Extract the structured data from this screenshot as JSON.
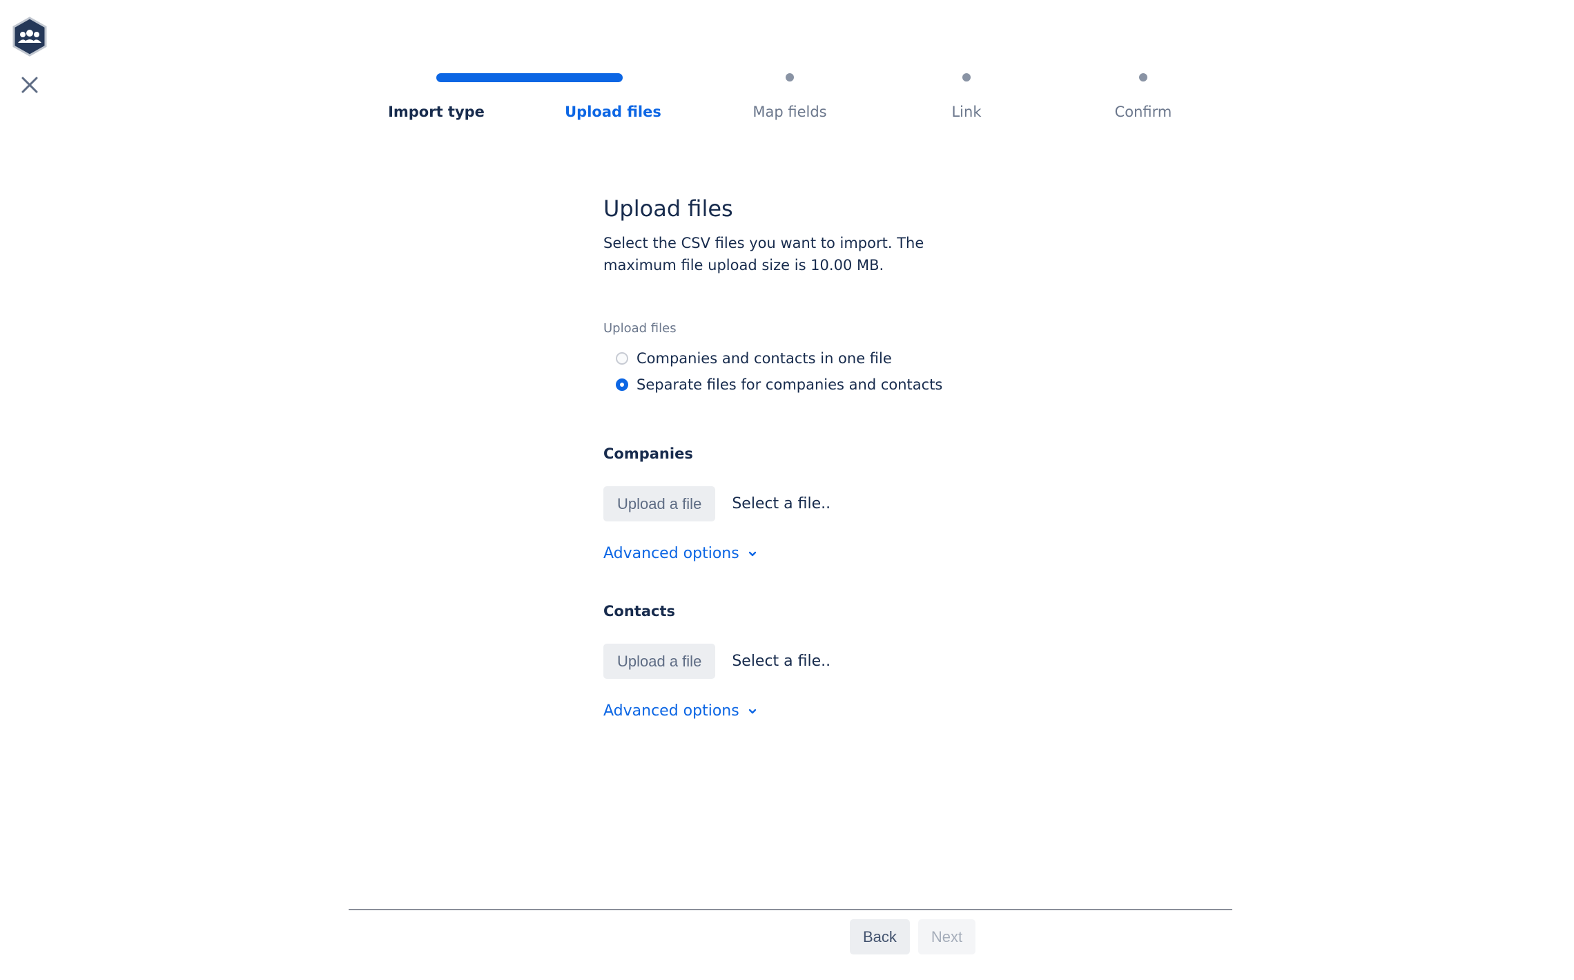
{
  "window": {
    "logo_icon": "team-hexagon-icon",
    "close_icon": "close-icon"
  },
  "tracker": {
    "steps": [
      {
        "label": "Import type",
        "state": "done"
      },
      {
        "label": "Upload files",
        "state": "current"
      },
      {
        "label": "Map fields",
        "state": "pending"
      },
      {
        "label": "Link",
        "state": "pending"
      },
      {
        "label": "Confirm",
        "state": "pending"
      }
    ],
    "progress_color": "#0c66e4"
  },
  "main": {
    "title": "Upload files",
    "description": "Select the CSV files you want to import. The maximum file upload size is 10.00 MB.",
    "upload_mode": {
      "label": "Upload files",
      "options": [
        {
          "label": "Companies and contacts in one file",
          "checked": false
        },
        {
          "label": "Separate files for companies and contacts",
          "checked": true
        }
      ]
    },
    "companies": {
      "title": "Companies",
      "upload_label": "Upload a file",
      "file_placeholder": "Select a file..",
      "advanced_label": "Advanced options"
    },
    "contacts": {
      "title": "Contacts",
      "upload_label": "Upload a file",
      "file_placeholder": "Select a file..",
      "advanced_label": "Advanced options"
    }
  },
  "footer": {
    "back_label": "Back",
    "next_label": "Next"
  }
}
